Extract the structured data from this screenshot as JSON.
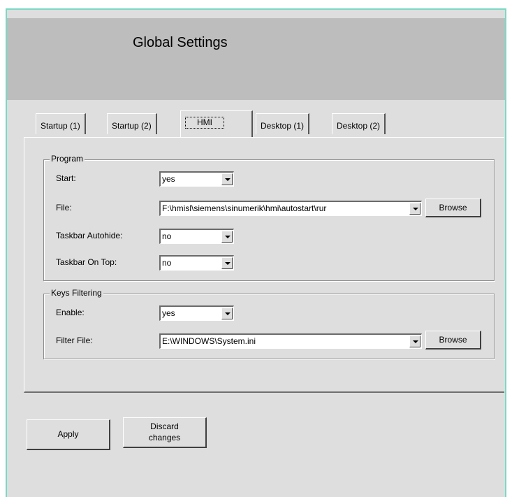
{
  "header": {
    "title": "Global Settings"
  },
  "tabs": [
    {
      "label": "Startup (1)"
    },
    {
      "label": "Startup (2)"
    },
    {
      "label": "HMI"
    },
    {
      "label": "Desktop (1)"
    },
    {
      "label": "Desktop (2)"
    }
  ],
  "active_tab": "HMI",
  "program": {
    "title": "Program",
    "start_label": "Start:",
    "start_value": "yes",
    "file_label": "File:",
    "file_value": "F:\\hmisl\\siemens\\sinumerik\\hmi\\autostart\\rur",
    "browse_label": "Browse",
    "autohide_label": "Taskbar Autohide:",
    "autohide_value": "no",
    "ontop_label": "Taskbar On Top:",
    "ontop_value": "no"
  },
  "keys": {
    "title": "Keys Filtering",
    "enable_label": "Enable:",
    "enable_value": "yes",
    "filter_label": "Filter File:",
    "filter_value": "E:\\WINDOWS\\System.ini",
    "browse_label": "Browse"
  },
  "actions": {
    "apply_label": "Apply",
    "discard_line1": "Discard",
    "discard_line2": "changes"
  },
  "colors": {
    "frame_accent": "#7ad9c4",
    "header_bg": "#bdbdbd",
    "panel_bg": "#dedede"
  }
}
